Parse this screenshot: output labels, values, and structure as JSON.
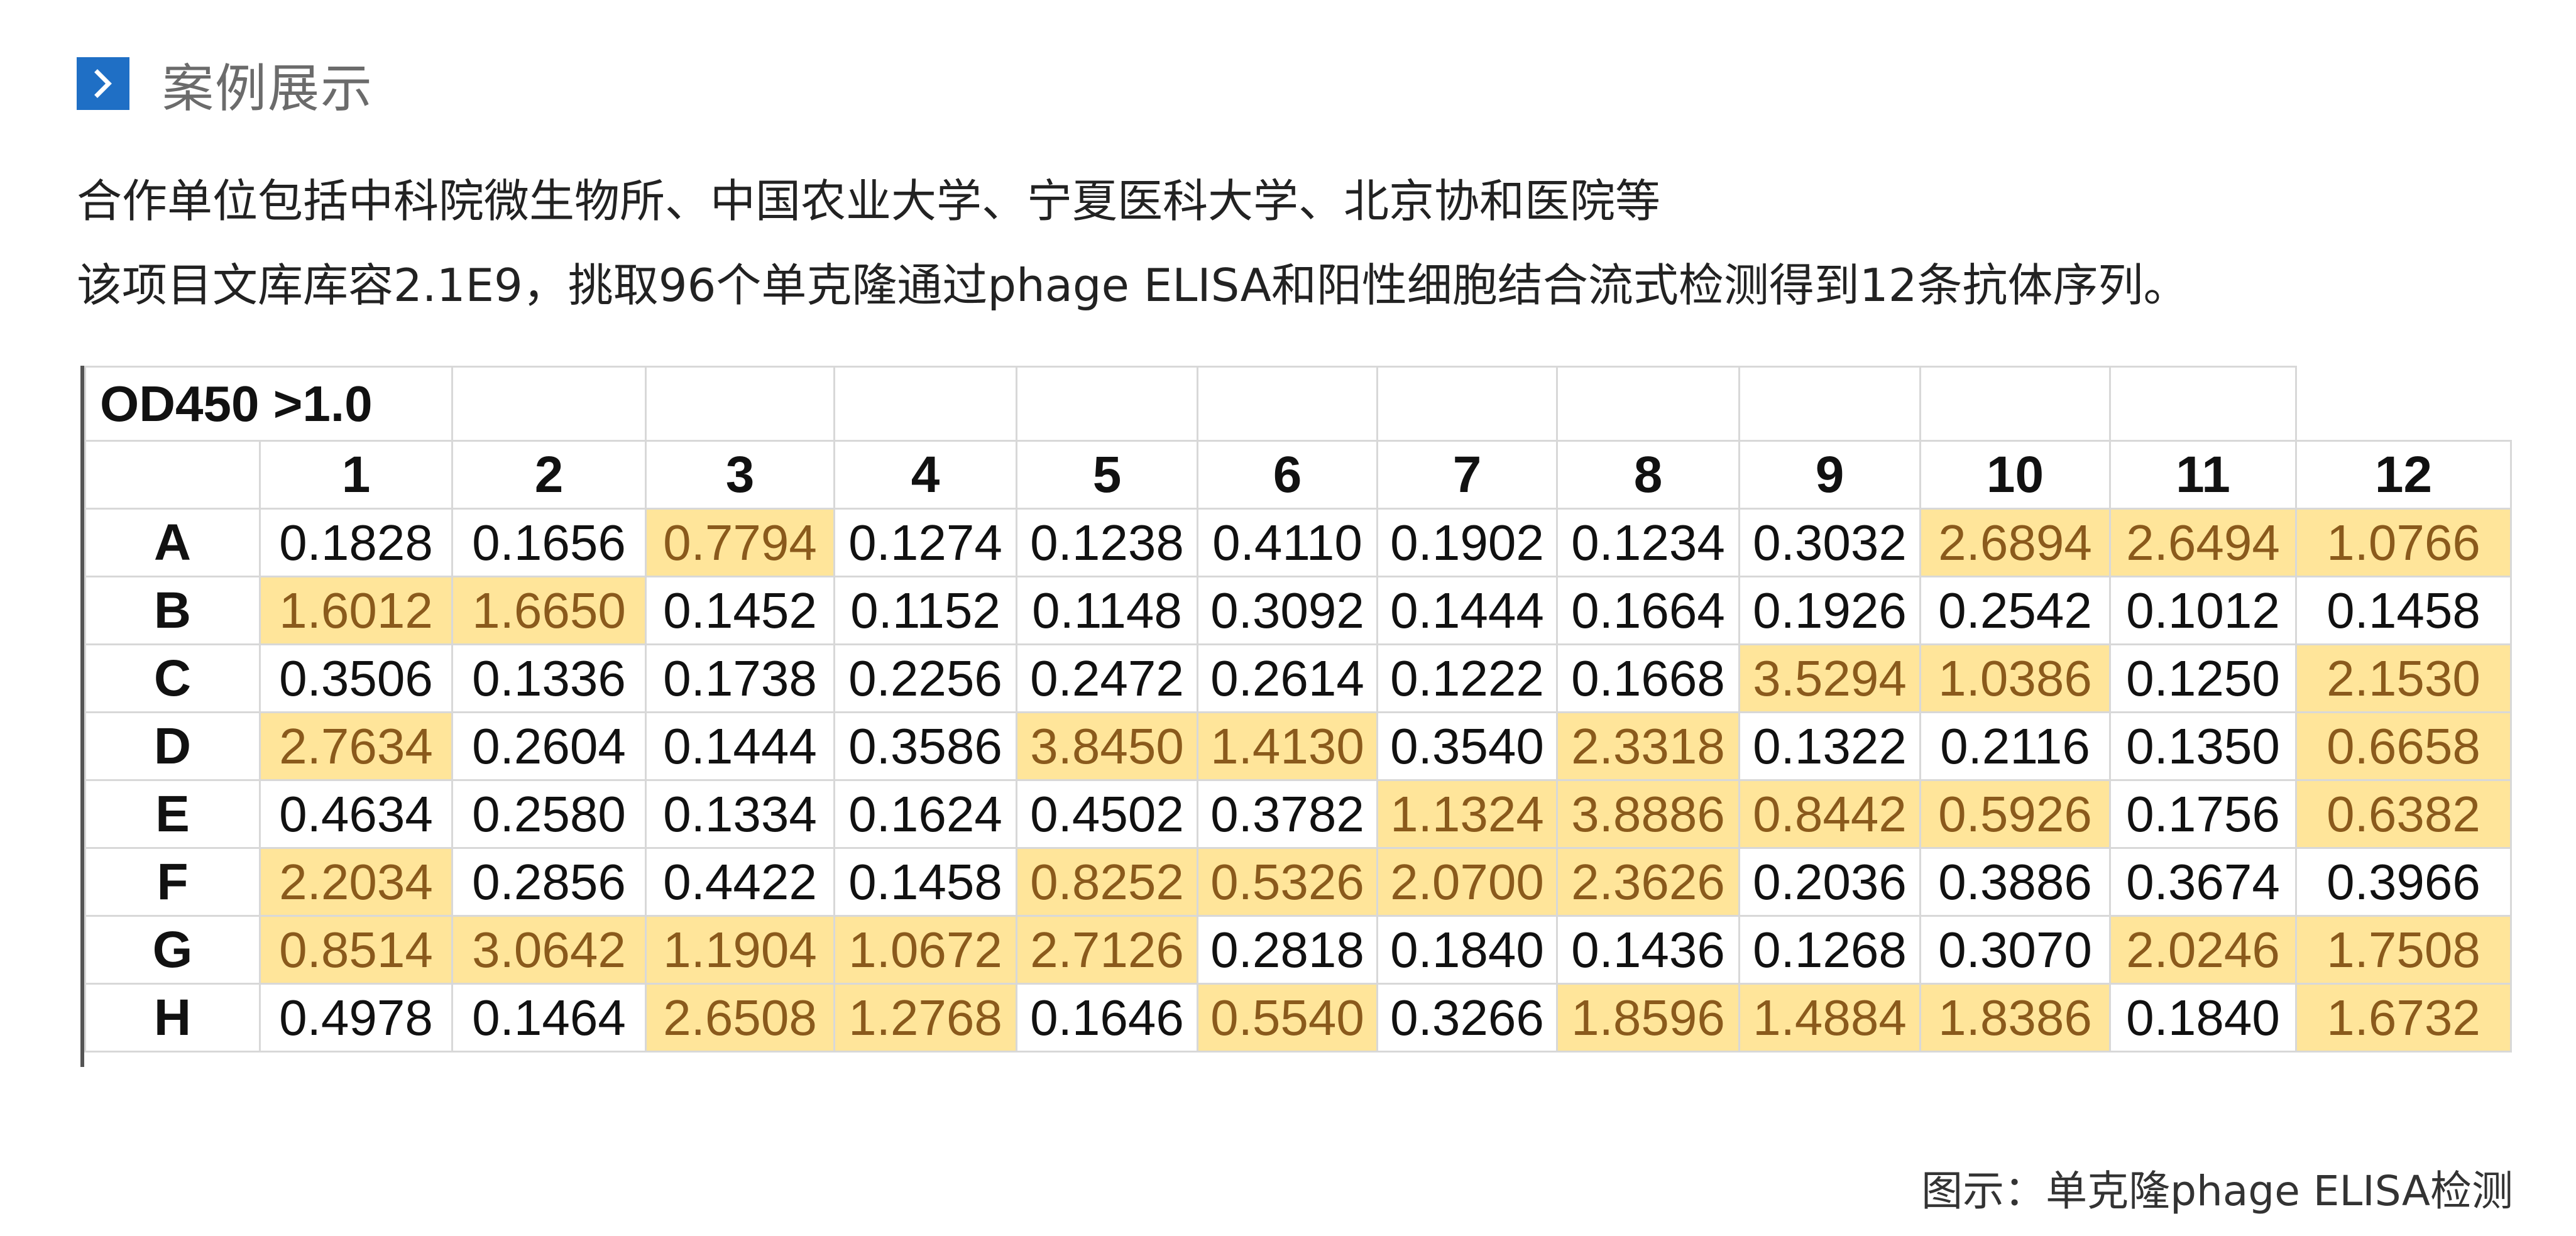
{
  "header": {
    "icon": "chevron-right-icon",
    "title": "案例展示",
    "accent_color": "#1f6fc5"
  },
  "intro": {
    "line1": "合作单位包括中科院微生物所、中国农业大学、宁夏医科大学、北京协和医院等",
    "line2": "该项目文库库容2.1E9，挑取96个单克隆通过phage ELISA和阳性细胞结合流式检测得到12条抗体序列。"
  },
  "table": {
    "title": "OD450  >1.0",
    "highlight_color": "#ffe59a",
    "highlight_text_color": "#8a5a1c",
    "columns": [
      "1",
      "2",
      "3",
      "4",
      "5",
      "6",
      "7",
      "8",
      "9",
      "10",
      "11",
      "12"
    ],
    "rows": [
      {
        "label": "A",
        "values": [
          "0.1828",
          "0.1656",
          "0.7794",
          "0.1274",
          "0.1238",
          "0.4110",
          "0.1902",
          "0.1234",
          "0.3032",
          "2.6894",
          "2.6494",
          "1.0766"
        ],
        "highlight": [
          false,
          false,
          true,
          false,
          false,
          false,
          false,
          false,
          false,
          true,
          true,
          true
        ]
      },
      {
        "label": "B",
        "values": [
          "1.6012",
          "1.6650",
          "0.1452",
          "0.1152",
          "0.1148",
          "0.3092",
          "0.1444",
          "0.1664",
          "0.1926",
          "0.2542",
          "0.1012",
          "0.1458"
        ],
        "highlight": [
          true,
          true,
          false,
          false,
          false,
          false,
          false,
          false,
          false,
          false,
          false,
          false
        ]
      },
      {
        "label": "C",
        "values": [
          "0.3506",
          "0.1336",
          "0.1738",
          "0.2256",
          "0.2472",
          "0.2614",
          "0.1222",
          "0.1668",
          "3.5294",
          "1.0386",
          "0.1250",
          "2.1530"
        ],
        "highlight": [
          false,
          false,
          false,
          false,
          false,
          false,
          false,
          false,
          true,
          true,
          false,
          true
        ]
      },
      {
        "label": "D",
        "values": [
          "2.7634",
          "0.2604",
          "0.1444",
          "0.3586",
          "3.8450",
          "1.4130",
          "0.3540",
          "2.3318",
          "0.1322",
          "0.2116",
          "0.1350",
          "0.6658"
        ],
        "highlight": [
          true,
          false,
          false,
          false,
          true,
          true,
          false,
          true,
          false,
          false,
          false,
          true
        ]
      },
      {
        "label": "E",
        "values": [
          "0.4634",
          "0.2580",
          "0.1334",
          "0.1624",
          "0.4502",
          "0.3782",
          "1.1324",
          "3.8886",
          "0.8442",
          "0.5926",
          "0.1756",
          "0.6382"
        ],
        "highlight": [
          false,
          false,
          false,
          false,
          false,
          false,
          true,
          true,
          true,
          true,
          false,
          true
        ]
      },
      {
        "label": "F",
        "values": [
          "2.2034",
          "0.2856",
          "0.4422",
          "0.1458",
          "0.8252",
          "0.5326",
          "2.0700",
          "2.3626",
          "0.2036",
          "0.3886",
          "0.3674",
          "0.3966"
        ],
        "highlight": [
          true,
          false,
          false,
          false,
          true,
          true,
          true,
          true,
          false,
          false,
          false,
          false
        ]
      },
      {
        "label": "G",
        "values": [
          "0.8514",
          "3.0642",
          "1.1904",
          "1.0672",
          "2.7126",
          "0.2818",
          "0.1840",
          "0.1436",
          "0.1268",
          "0.3070",
          "2.0246",
          "1.7508"
        ],
        "highlight": [
          true,
          true,
          true,
          true,
          true,
          false,
          false,
          false,
          false,
          false,
          true,
          true
        ]
      },
      {
        "label": "H",
        "values": [
          "0.4978",
          "0.1464",
          "2.6508",
          "1.2768",
          "0.1646",
          "0.5540",
          "0.3266",
          "1.8596",
          "1.4884",
          "1.8386",
          "0.1840",
          "1.6732"
        ],
        "highlight": [
          false,
          false,
          true,
          true,
          false,
          true,
          false,
          true,
          true,
          true,
          false,
          true
        ]
      }
    ]
  },
  "caption": "图示：单克隆phage ELISA检测"
}
